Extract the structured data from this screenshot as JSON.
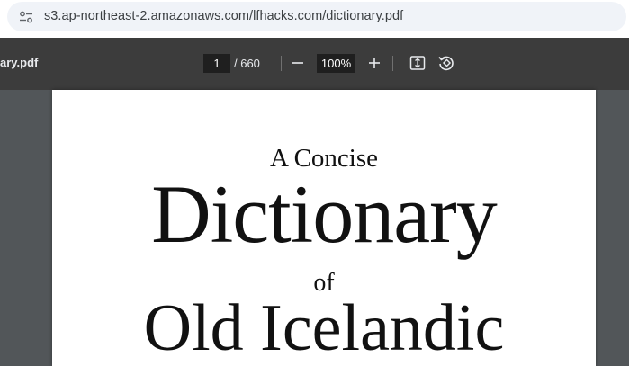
{
  "address_bar": {
    "url": "s3.ap-northeast-2.amazonaws.com/lfhacks.com/dictionary.pdf",
    "site_info_icon": "tune-icon"
  },
  "pdf_toolbar": {
    "title": "ary.pdf",
    "page_current": "1",
    "page_total": "/ 660",
    "zoom": "100%",
    "icons": [
      "zoom-out-icon",
      "zoom-in-icon",
      "fit-page-icon",
      "rotate-icon"
    ]
  },
  "document": {
    "line1": "A Concise",
    "line2": "Dictionary",
    "line3": "of",
    "line4": "Old Icelandic"
  },
  "colors": {
    "toolbar_bg": "#3c3c3c",
    "viewer_bg": "#525659",
    "page_bg": "#ffffff",
    "url_pill_bg": "#f0f3f8"
  }
}
